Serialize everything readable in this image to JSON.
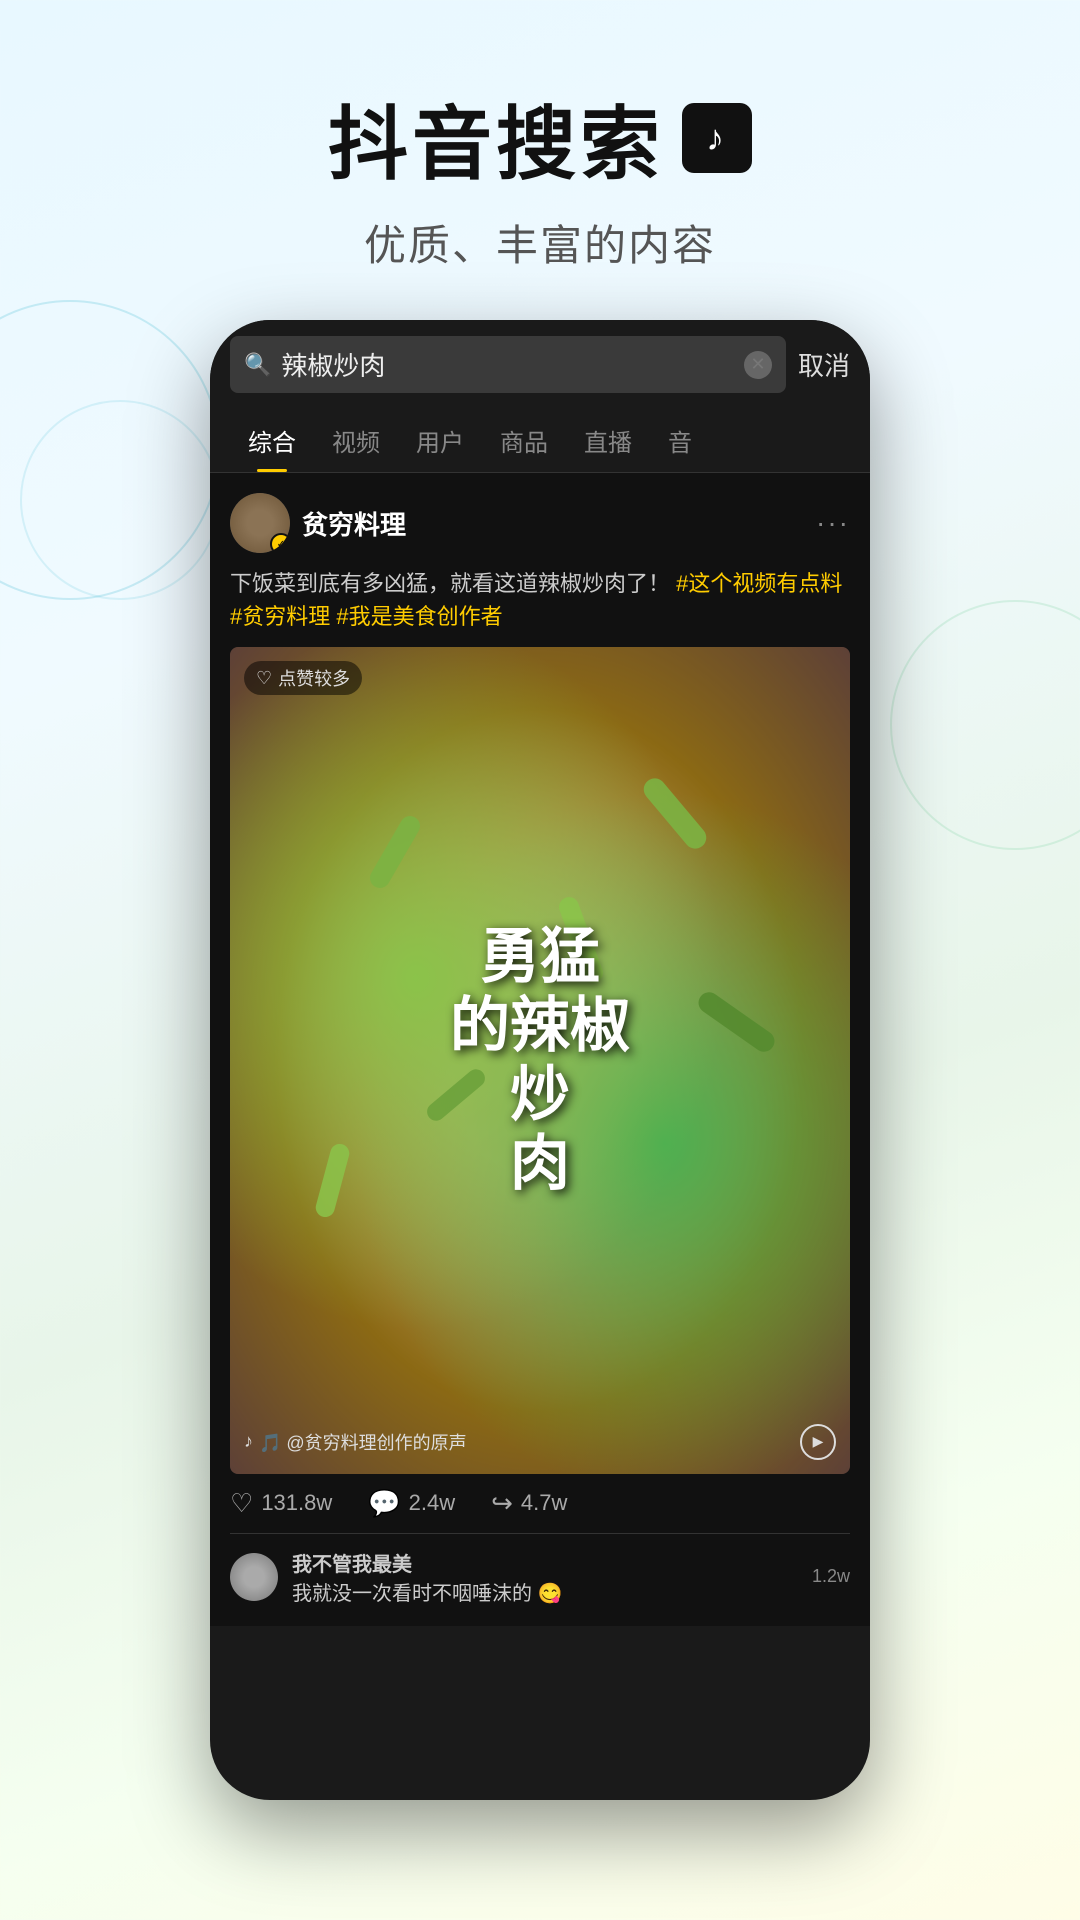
{
  "header": {
    "title": "抖音搜索",
    "logo_symbol": "♪",
    "subtitle": "优质、丰富的内容"
  },
  "search": {
    "query": "辣椒炒肉",
    "cancel_label": "取消"
  },
  "tabs": [
    {
      "label": "综合",
      "active": true
    },
    {
      "label": "视频",
      "active": false
    },
    {
      "label": "用户",
      "active": false
    },
    {
      "label": "商品",
      "active": false
    },
    {
      "label": "直播",
      "active": false
    },
    {
      "label": "音",
      "active": false
    }
  ],
  "post": {
    "username": "贫穷料理",
    "verified": true,
    "more": "···",
    "description": "下饭菜到底有多凶猛，就看这道辣椒炒肉了！",
    "hashtags": [
      "#这个视频有点料",
      "#贫穷料理",
      "#我是美食创作者"
    ],
    "video": {
      "likes_badge": "♡ 点赞较多",
      "overlay_text": "勇猛的辣椒炒肉",
      "sound_text": "🎵 @贫穷料理创作的原声"
    },
    "stats": {
      "likes": "131.8w",
      "comments": "2.4w",
      "shares": "4.7w"
    }
  },
  "comment": {
    "username": "我不管我最美",
    "text": "我就没一次看时不咽唾沫的 😋",
    "likes": "1.2w"
  },
  "colors": {
    "accent": "#ffcc00",
    "background": "#1a1a1a",
    "text_primary": "#ffffff",
    "text_secondary": "#aaaaaa"
  }
}
